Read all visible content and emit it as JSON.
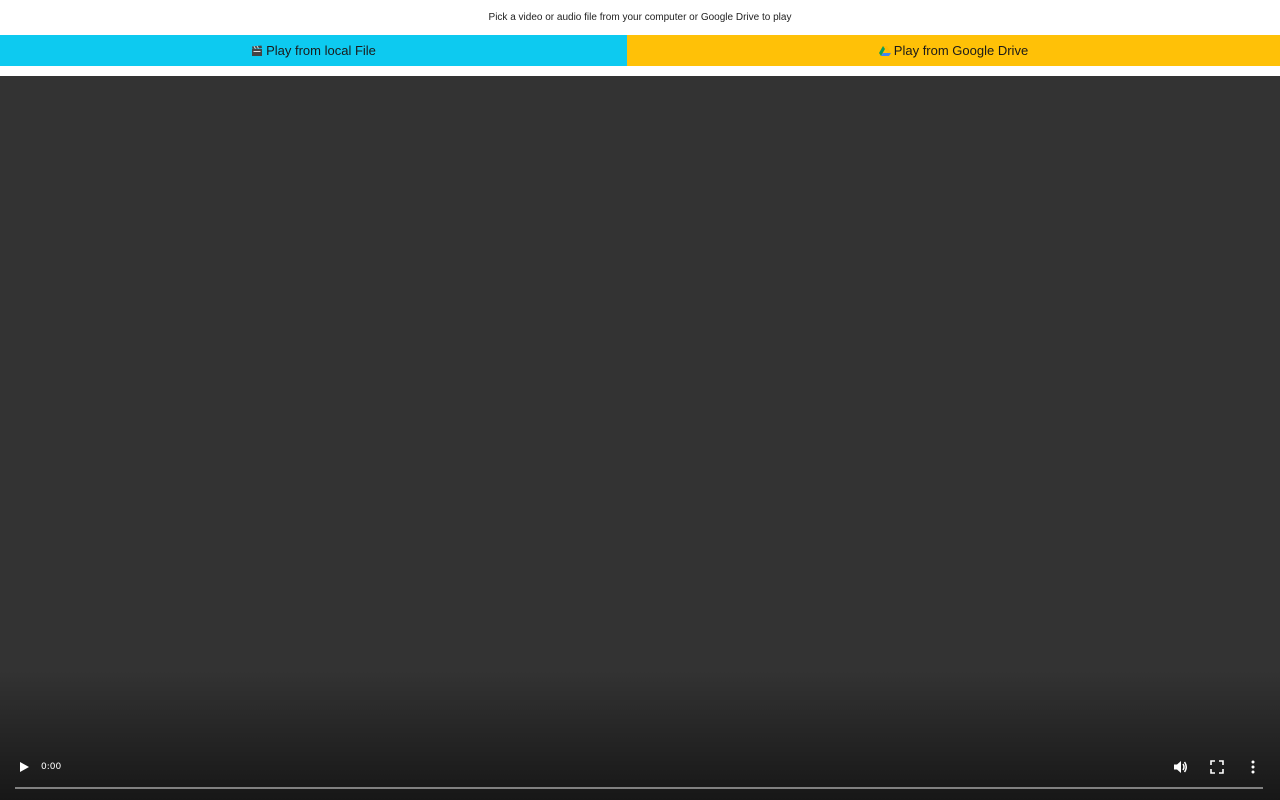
{
  "header": {
    "instruction": "Pick a video or audio file from your computer or Google Drive to play"
  },
  "buttons": {
    "local": {
      "label": "Play from local File",
      "icon": "clapperboard-icon",
      "color": "#0dcaf0"
    },
    "drive": {
      "label": "Play from Google Drive",
      "icon": "google-drive-icon",
      "color": "#ffc107"
    }
  },
  "player": {
    "background": "#333333",
    "time": "0:00",
    "progress": 0,
    "icons": [
      "play-icon",
      "volume-icon",
      "fullscreen-icon",
      "more-options-icon"
    ]
  }
}
